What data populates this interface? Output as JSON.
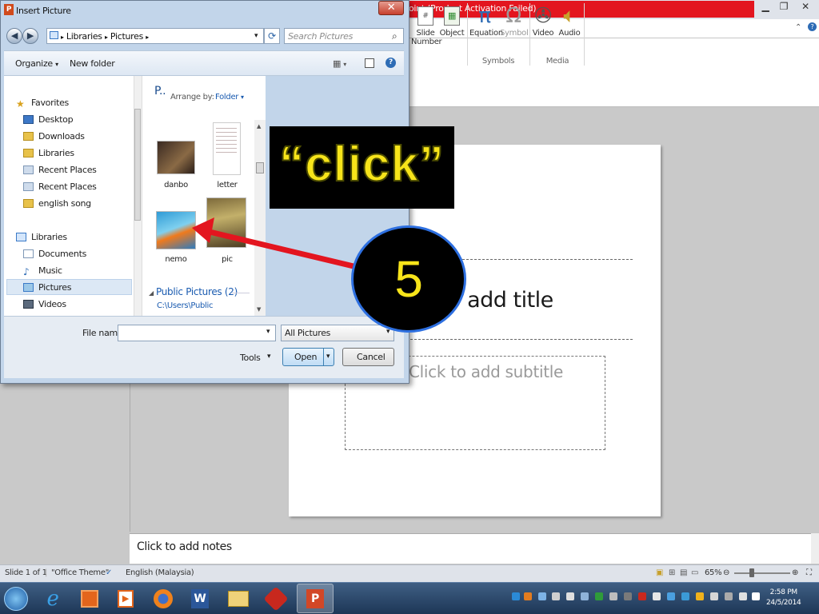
{
  "ppt": {
    "title_fragment": "oint (Product Activation Failed)",
    "ribbon": {
      "insert_buttons": [
        {
          "label": "Slide\nNumber",
          "icon": "slide-number-icon"
        },
        {
          "label": "Object",
          "icon": "object-icon"
        },
        {
          "label": "Equation",
          "icon": "pi-icon"
        },
        {
          "label": "Symbol",
          "icon": "omega-icon"
        },
        {
          "label": "Video",
          "icon": "film-reel-icon"
        },
        {
          "label": "Audio",
          "icon": "speaker-icon"
        }
      ],
      "groups": [
        "Symbols",
        "Media"
      ]
    },
    "slide": {
      "title_placeholder": "o add title",
      "subtitle_placeholder": "Click to add subtitle"
    },
    "notes_placeholder": "Click to add notes",
    "status": {
      "slide": "Slide 1 of 1",
      "theme": "\"Office Theme\"",
      "language": "English (Malaysia)",
      "zoom": "65%"
    }
  },
  "dialog": {
    "title": "Insert Picture",
    "breadcrumb": [
      "Libraries",
      "Pictures"
    ],
    "search_placeholder": "Search Pictures",
    "toolbar": {
      "organize": "Organize",
      "new_folder": "New folder"
    },
    "nav": {
      "favorites_label": "Favorites",
      "favorites": [
        "Desktop",
        "Downloads",
        "Libraries",
        "Recent Places",
        "Recent Places",
        "english song"
      ],
      "libraries_label": "Libraries",
      "libraries": [
        "Documents",
        "Music",
        "Pictures",
        "Videos"
      ],
      "selected": "Pictures"
    },
    "files": {
      "header": "P..",
      "arrange_by": "Arrange by:",
      "arrange_value": "Folder",
      "items": [
        "danbo",
        "letter",
        "nemo",
        "pic"
      ],
      "public_group": "Public Pictures (2)",
      "public_path": "C:\\Users\\Public"
    },
    "bottom": {
      "file_name_label": "File name:",
      "file_name_value": "",
      "filter": "All Pictures",
      "tools": "Tools",
      "open": "Open",
      "cancel": "Cancel"
    }
  },
  "annotation": {
    "callout": "“click”",
    "step": "5",
    "arrow_color": "#e3151f",
    "callout_color": "#f7e41a"
  },
  "taskbar": {
    "apps": [
      "start-orb-icon",
      "internet-explorer-icon",
      "office-icon",
      "media-player-icon",
      "firefox-icon",
      "word-icon",
      "explorer-folder-icon",
      "red-app-icon",
      "powerpoint-icon"
    ],
    "time": "2:58 PM",
    "date": "24/5/2014"
  }
}
